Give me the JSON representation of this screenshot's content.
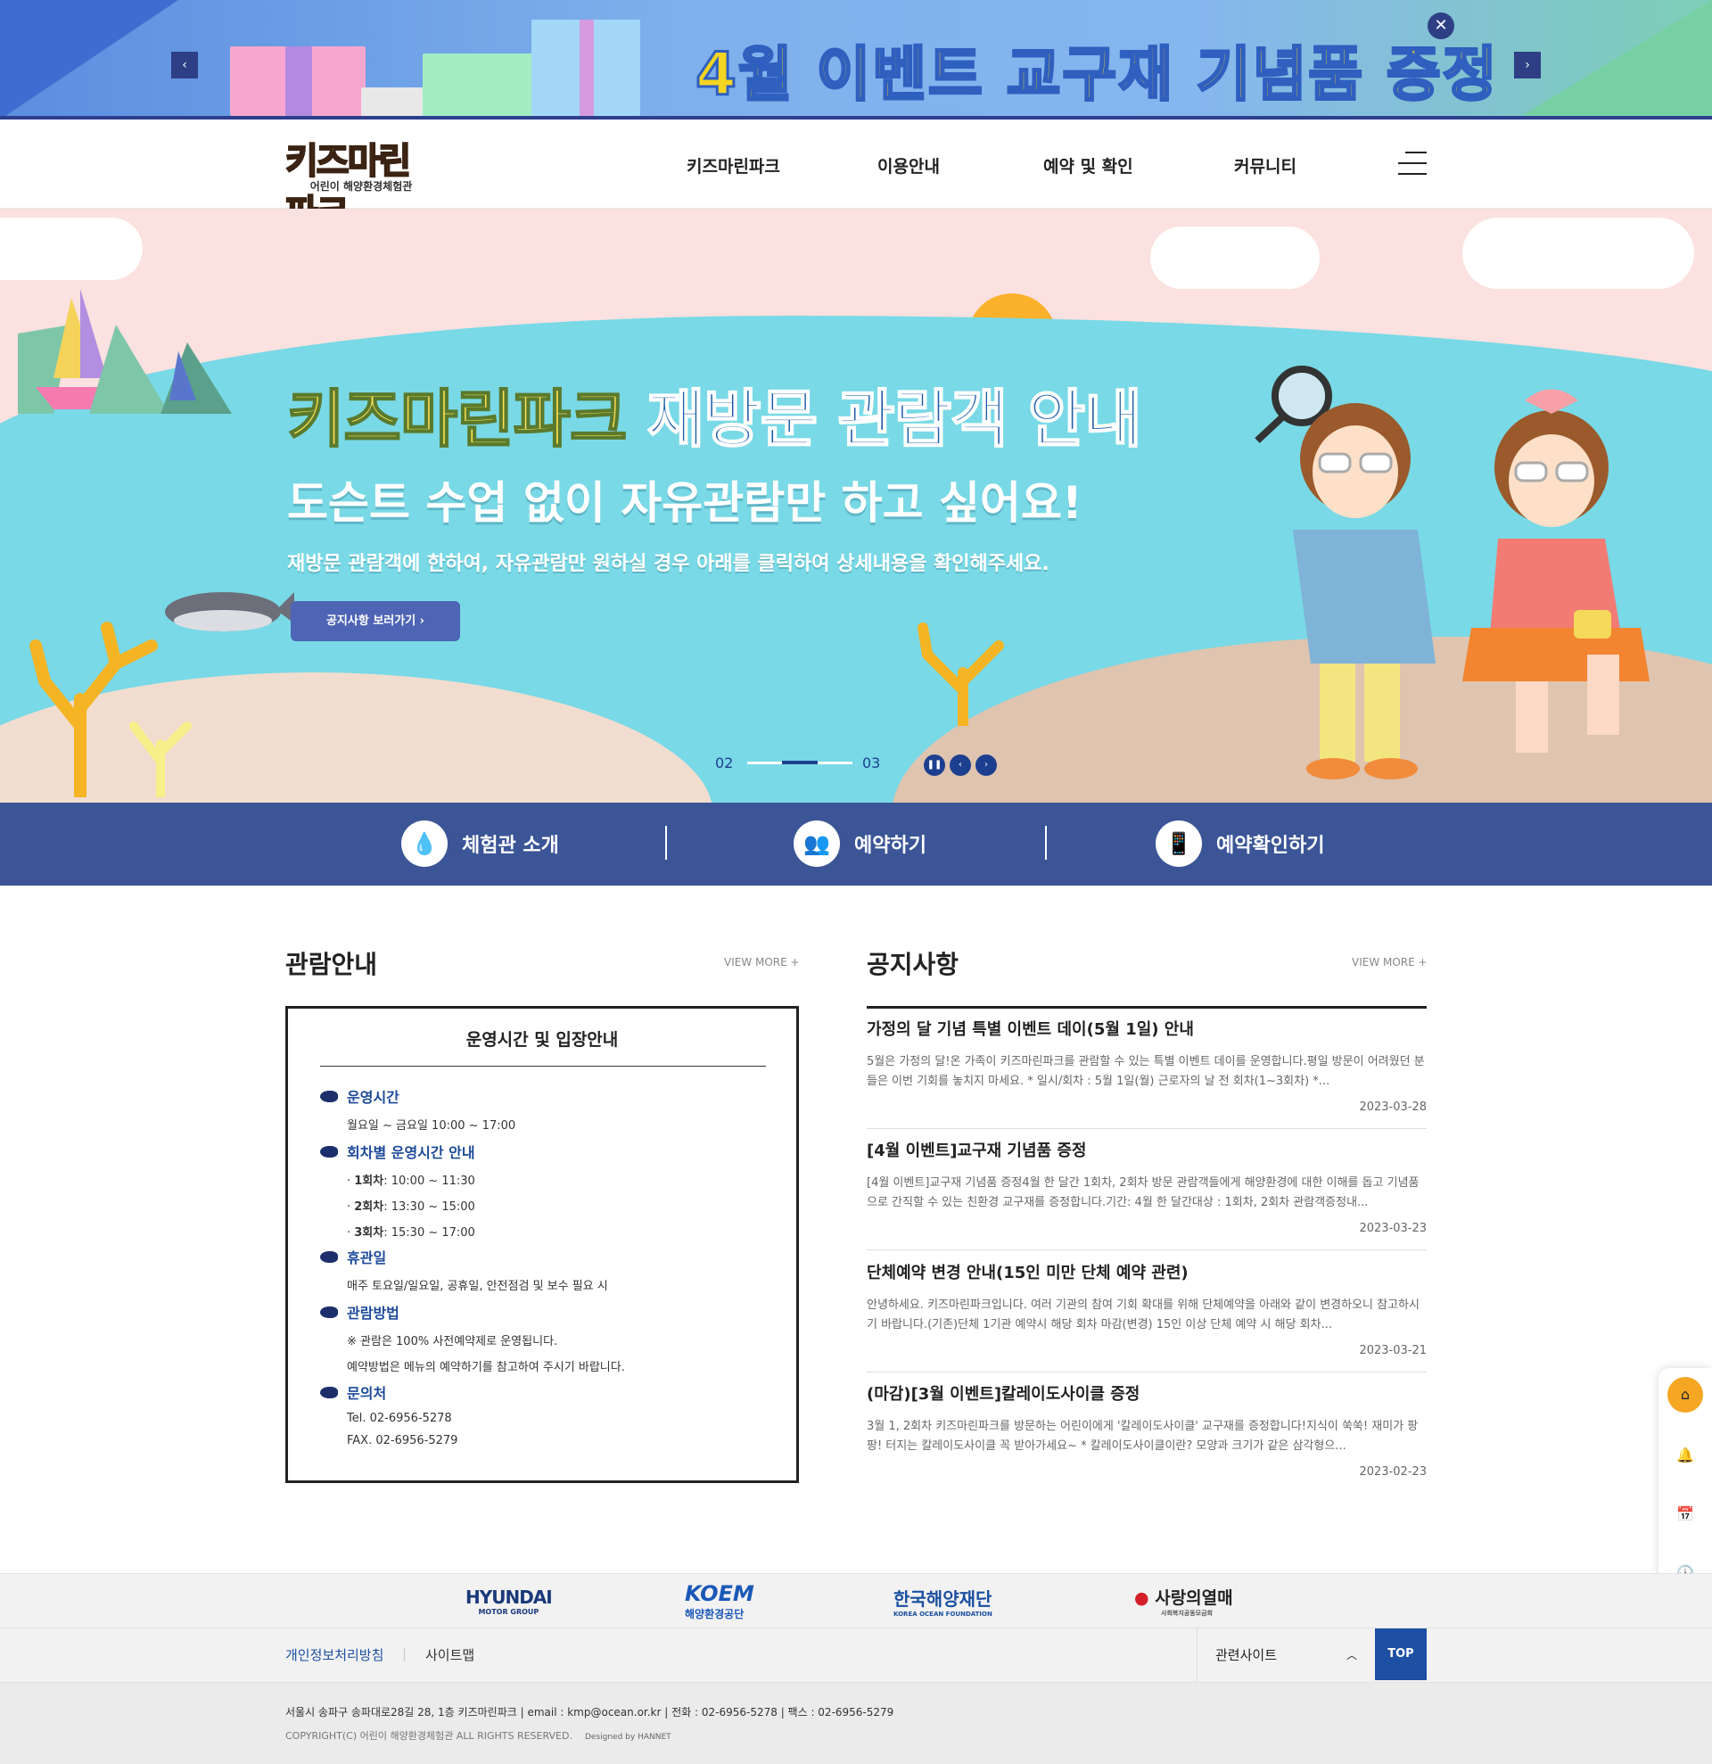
{
  "promo": {
    "title": "4월 이벤트 교구재 기념품 증정",
    "prev_icon": "‹",
    "next_icon": "›",
    "close_icon": "✕"
  },
  "header": {
    "logo_text": "키즈마린파크",
    "logo_sub": "어린이 해양환경체험관",
    "nav": [
      "키즈마린파크",
      "이용안내",
      "예약 및 확인",
      "커뮤니티"
    ]
  },
  "hero": {
    "title_part1": "키즈마린파크",
    "title_part2": "재방문 관람객 안내",
    "subtitle": "도슨트 수업 없이 자유관람만 하고 싶어요!",
    "desc": "재방문 관람객에 한하여, 자유관람만 원하실 경우 아래를 클릭하여 상세내용을 확인해주세요.",
    "button": "공지사항 보러가기  ›",
    "slide_current": "02",
    "slide_next": "03",
    "progress": 0.5
  },
  "quick": [
    {
      "label": "체험관 소개",
      "icon": "droplet-icon",
      "glyph": "💧"
    },
    {
      "label": "예약하기",
      "icon": "people-icon",
      "glyph": "👥"
    },
    {
      "label": "예약확인하기",
      "icon": "phone-icon",
      "glyph": "📱"
    }
  ],
  "guide": {
    "title": "관람안내",
    "view_more": "VIEW MORE +",
    "box_title": "운영시간 및 입장안내",
    "sections": [
      {
        "head": "운영시간",
        "lines": [
          "월요일 ~ 금요일 10:00 ~ 17:00"
        ]
      },
      {
        "head": "회차별 운영시간 안내",
        "lines": [
          "· 1회차: 10:00 ~ 11:30",
          "· 2회차: 13:30 ~ 15:00",
          "· 3회차: 15:30 ~ 17:00"
        ]
      },
      {
        "head": "휴관일",
        "lines": [
          "매주 토요일/일요일, 공휴일, 안전점검 및 보수 필요 시"
        ]
      },
      {
        "head": "관람방법",
        "lines": [
          "※ 관람은 100% 사전예약제로 운영됩니다.",
          "예약방법은 메뉴의 예약하기를 참고하여 주시기 바랍니다."
        ]
      },
      {
        "head": "문의처",
        "lines": [
          "Tel. 02-6956-5278",
          "FAX. 02-6956-5279"
        ]
      }
    ]
  },
  "notice": {
    "title": "공지사항",
    "view_more": "VIEW MORE +",
    "items": [
      {
        "title": "가정의 달 기념 특별 이벤트 데이(5월 1일) 안내",
        "desc": "5월은 가정의 달!온 가족이 키즈마린파크를 관람할 수 있는 특별 이벤트 데이를 운영합니다.평일 방문이 어려웠던 분들은 이번 기회를 놓치지 마세요.  * 일시/회차 : 5월 1일(월) 근로자의 날 전 회차(1~3회차)  *...",
        "date": "2023-03-28"
      },
      {
        "title": "[4월 이벤트]교구재 기념품 증정",
        "desc": "[4월 이벤트]교구재 기념품 증정4월 한 달간 1회차, 2회차 방문 관람객들에게 해양환경에 대한 이해를 돕고 기념품으로 간직할 수 있는 친환경 교구재를 증정합니다.기간: 4월 한 달간대상 : 1회차, 2회차 관람객증정내...",
        "date": "2023-03-23"
      },
      {
        "title": "단체예약 변경 안내(15인 미만 단체 예약 관련)",
        "desc": "안녕하세요. 키즈마린파크입니다.  여러 기관의 참여 기회 확대를 위해 단체예약을 아래와 같이 변경하오니 참고하시기 바랍니다.(기존)단체 1기관 예약시 해당 회차 마감(변경) 15인 이상 단체 예약 시 해당 회차...",
        "date": "2023-03-21"
      },
      {
        "title": "(마감)[3월 이벤트]칼레이도사이클 증정",
        "desc": "3월 1, 2회차 키즈마린파크를 방문하는 어린이에게 '칼레이도사이클' 교구재를 증정합니다!지식이 쑥쑥! 재미가 팡팡! 터지는 칼레이도사이클 꼭 받아가세요~  * 칼레이도사이클이란? 모양과 크기가 같은 삼각형으...",
        "date": "2023-02-23"
      }
    ]
  },
  "sidebar": [
    {
      "icon": "home-icon",
      "glyph": "⌂"
    },
    {
      "icon": "bell-icon",
      "glyph": "🔔"
    },
    {
      "icon": "calendar-icon",
      "glyph": "📅"
    },
    {
      "icon": "clock-icon",
      "glyph": "🕓"
    },
    {
      "icon": "map-pin-icon",
      "glyph": "📍"
    }
  ],
  "partners": [
    {
      "name": "HYUNDAI",
      "sub": "MOTOR GROUP",
      "color": "#1b3a7a"
    },
    {
      "name": "KOEM",
      "sub": "해양환경공단",
      "color": "#1a58b8"
    },
    {
      "name": "한국해양재단",
      "sub": "KOREA OCEAN FOUNDATION",
      "color": "#1a4fa0"
    },
    {
      "name": "사랑의열매",
      "sub": "사회복지공동모금회",
      "color": "#222222"
    }
  ],
  "footer_links": {
    "privacy": "개인정보처리방침",
    "sitemap": "사이트맵",
    "related": "관련사이트",
    "top": "TOP"
  },
  "footer": {
    "address": "서울시 송파구 송파대로28길 28, 1층 키즈마린파크   |   email : kmp@ocean.or.kr   |   전화 : 02-6956-5278   |   팩스 : 02-6956-5279",
    "copyright": "COPYRIGHT(C) 어린이 해양환경체험관 ALL RIGHTS RESERVED.",
    "designed": "Designed by HANNET"
  },
  "colors": {
    "navy": "#3b5597",
    "accent_blue": "#1d4fa3",
    "hero_sea": "#79d9e6"
  }
}
